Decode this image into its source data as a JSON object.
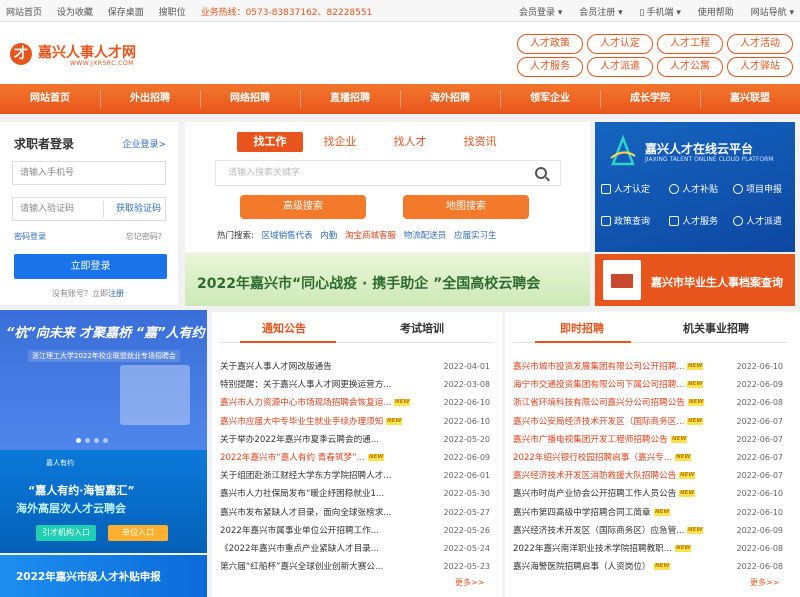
{
  "topbar": {
    "links": [
      "网站首页",
      "设为收藏",
      "保存桌面",
      "搜职位"
    ],
    "hotline": "业务热线：0573-83837162、82228551",
    "right": [
      "会员登录 ▾",
      "会员注册 ▾",
      "手机端 ▾",
      "使用帮助",
      "网站导航 ▾"
    ]
  },
  "brand": {
    "name": "嘉兴人事人才网",
    "url": "WWW.JXRSRC.COM",
    "mark": "才"
  },
  "quicklinks": [
    "人才政策",
    "人才认定",
    "人才工程",
    "人才活动",
    "人才服务",
    "人才派遣",
    "人才公寓",
    "人才驿站"
  ],
  "nav": [
    "网站首页",
    "外出招聘",
    "网络招聘",
    "直播招聘",
    "海外招聘",
    "领军企业",
    "成长学院",
    "嘉兴联盟"
  ],
  "login": {
    "title": "求职者登录",
    "alt_link": "企业登录>",
    "phone_placeholder": "请输入手机号",
    "code_placeholder": "请输入验证码",
    "code_button": "获取验证码",
    "password_login": "密码登录",
    "forgot": "忘记密码?",
    "submit": "立即登录",
    "no_account": "没有账号？立即",
    "register": "注册"
  },
  "search": {
    "tabs": [
      "找工作",
      "找企业",
      "找人才",
      "找资讯"
    ],
    "placeholder": "请输入搜索关键字",
    "advanced": "高级搜索",
    "map": "地图搜索",
    "hot_label": "热门搜索:",
    "hot_terms": [
      "区域销售代表",
      "内勤",
      "淘宝商城客服",
      "物流配送员",
      "应届实习生"
    ]
  },
  "banners": {
    "center": "2022年嘉兴市“同心战疫 · 携手助企 ”全国高校云聘会",
    "cloud_title": "嘉兴人才在线云平台",
    "cloud_sub": "JIAXING TALENT ONLINE CLOUD PLATFORM",
    "cloud_items": [
      "人才认定",
      "人才补贴",
      "项目申报",
      "政策查询",
      "人才服务",
      "人才派遣"
    ],
    "archive": "嘉兴市毕业生人事档案查询",
    "left1_title": "“杭”向未来  才聚嘉桥 “嘉”人有约",
    "left1_sub": "浙江理工大学2022年校企联盟就业专场招聘会",
    "left2_small": "嘉人有约",
    "left2_title": "“嘉人有约·海智嘉汇”",
    "left2_sub": "海外高层次人才云聘会",
    "left2_btn1": "引才机构入口",
    "left2_btn2": "单位入口",
    "left3": "2022年嘉兴市级人才补贴申报"
  },
  "notice": {
    "tabs": [
      "通知公告",
      "考试培训"
    ],
    "items": [
      {
        "title": "关于嘉兴人事人才网改版通告",
        "date": "2022-04-01",
        "red": false,
        "new": false
      },
      {
        "title": "特别提醒：关于嘉兴人事人才网更换运营方...",
        "date": "2022-03-08",
        "red": false,
        "new": false
      },
      {
        "title": "嘉兴市人力资源中心市场现场招聘会恢复运...",
        "date": "2022-06-10",
        "red": true,
        "new": true
      },
      {
        "title": "嘉兴市应届大中专毕业生就业手续办理须知",
        "date": "2022-06-10",
        "red": true,
        "new": true
      },
      {
        "title": "关于举办2022年嘉兴市夏季云聘会的通...",
        "date": "2022-05-20",
        "red": false,
        "new": false
      },
      {
        "title": "2022年嘉兴市“嘉人有约 青春筑梦”...",
        "date": "2022-06-09",
        "red": true,
        "new": true
      },
      {
        "title": "关于组团赴浙江财经大学东方学院招聘人才...",
        "date": "2022-06-01",
        "red": false,
        "new": false
      },
      {
        "title": "嘉兴市人力社保局发布“暖企纾困稳就业1...",
        "date": "2022-05-30",
        "red": false,
        "new": false
      },
      {
        "title": "嘉兴市发布紧缺人才目录，面向全球张榜求...",
        "date": "2022-05-27",
        "red": false,
        "new": false
      },
      {
        "title": "2022年嘉兴市属事业单位公开招聘工作...",
        "date": "2022-05-26",
        "red": false,
        "new": false
      },
      {
        "title": "《2022年嘉兴市重点产业紧缺人才目录...",
        "date": "2022-05-24",
        "red": false,
        "new": false
      },
      {
        "title": "第六届“红船杯”嘉兴全球创业创新大赛公...",
        "date": "2022-05-23",
        "red": false,
        "new": false
      }
    ],
    "more": "更多>>"
  },
  "recruit": {
    "tabs": [
      "即时招聘",
      "机关事业招聘"
    ],
    "items": [
      {
        "title": "嘉兴市城市投资发展集团有限公司公开招聘...",
        "date": "2022-06-10",
        "red": true,
        "new": true
      },
      {
        "title": "海宁市交通投资集团有限公司下属公司招聘...",
        "date": "2022-06-09",
        "red": true,
        "new": true
      },
      {
        "title": "浙江省环境科技有限公司嘉兴分公司招聘公告",
        "date": "2022-06-08",
        "red": true,
        "new": true
      },
      {
        "title": "嘉兴市公安局经济技术开发区（国际商务区...",
        "date": "2022-06-07",
        "red": true,
        "new": true
      },
      {
        "title": "嘉兴市广播电视集团开发工程师招聘公告",
        "date": "2022-06-07",
        "red": true,
        "new": true
      },
      {
        "title": "2022年绍兴银行校园招聘启事（嘉兴专...",
        "date": "2022-06-07",
        "red": true,
        "new": true
      },
      {
        "title": "嘉兴经济技术开发区消防救援大队招聘公告",
        "date": "2022-06-07",
        "red": true,
        "new": true
      },
      {
        "title": "嘉兴市时尚产业协会公开招聘工作人员公告",
        "date": "2022-06-10",
        "red": false,
        "new": true
      },
      {
        "title": "嘉兴市第四高级中学招聘合同工简章",
        "date": "2022-06-10",
        "red": false,
        "new": true
      },
      {
        "title": "嘉兴经济技术开发区（国际商务区）应急管...",
        "date": "2022-06-09",
        "red": false,
        "new": true
      },
      {
        "title": "2022年嘉兴南洋职业技术学院招聘教职...",
        "date": "2022-06-08",
        "red": false,
        "new": true
      },
      {
        "title": "嘉兴海警医院招聘启事（人资岗位）",
        "date": "2022-06-08",
        "red": false,
        "new": true
      }
    ],
    "more": "更多>>"
  },
  "colors": {
    "accent": "#e8551c",
    "link": "#2f6fc1",
    "login_button": "#1a73e8"
  }
}
